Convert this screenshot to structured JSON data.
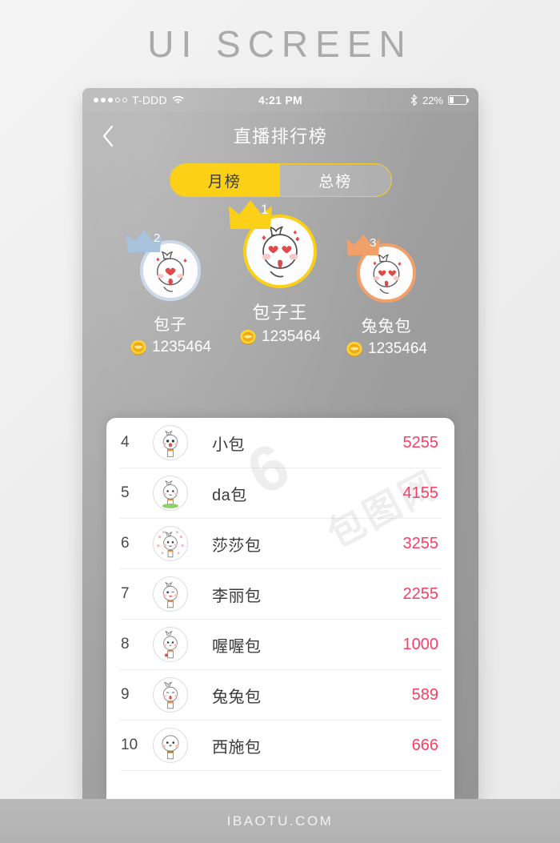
{
  "page": {
    "header_title": "UI SCREEN",
    "footer_text": "IBAOTU.COM",
    "watermark_1": "6",
    "watermark_2": "包图网"
  },
  "status_bar": {
    "carrier": "T-DDD",
    "time": "4:21 PM",
    "battery_percent": "22%",
    "signal_dots_filled": 3,
    "signal_dots_total": 5,
    "wifi_icon": "wifi-icon",
    "bluetooth_icon": "bluetooth-icon",
    "battery_icon": "battery-icon"
  },
  "nav": {
    "back_icon": "chevron-left-icon",
    "title": "直播排行榜"
  },
  "tabs": {
    "items": [
      {
        "label": "月榜",
        "active": true
      },
      {
        "label": "总榜",
        "active": false
      }
    ],
    "active_color": "#fbd017",
    "border_color": "#f6cf24"
  },
  "podium": [
    {
      "rank": "1",
      "name": "包子王",
      "score": "1235464",
      "crown_color": "#fbd017",
      "ring_color": "#fbd017"
    },
    {
      "rank": "2",
      "name": "包子",
      "score": "1235464",
      "crown_color": "#a9c3dd",
      "ring_color": "#ccd9e8"
    },
    {
      "rank": "3",
      "name": "兔兔包",
      "score": "1235464",
      "crown_color": "#f2a06a",
      "ring_color": "#f2a06a"
    }
  ],
  "list": {
    "score_color": "#fb3e62",
    "rows": [
      {
        "rank": "4",
        "name": "小包",
        "score": "5255"
      },
      {
        "rank": "5",
        "name": "da包",
        "score": "4155"
      },
      {
        "rank": "6",
        "name": "莎莎包",
        "score": "3255"
      },
      {
        "rank": "7",
        "name": "李丽包",
        "score": "2255"
      },
      {
        "rank": "8",
        "name": "喔喔包",
        "score": "1000"
      },
      {
        "rank": "9",
        "name": "兔兔包",
        "score": "589"
      },
      {
        "rank": "10",
        "name": "西施包",
        "score": "666"
      }
    ]
  }
}
